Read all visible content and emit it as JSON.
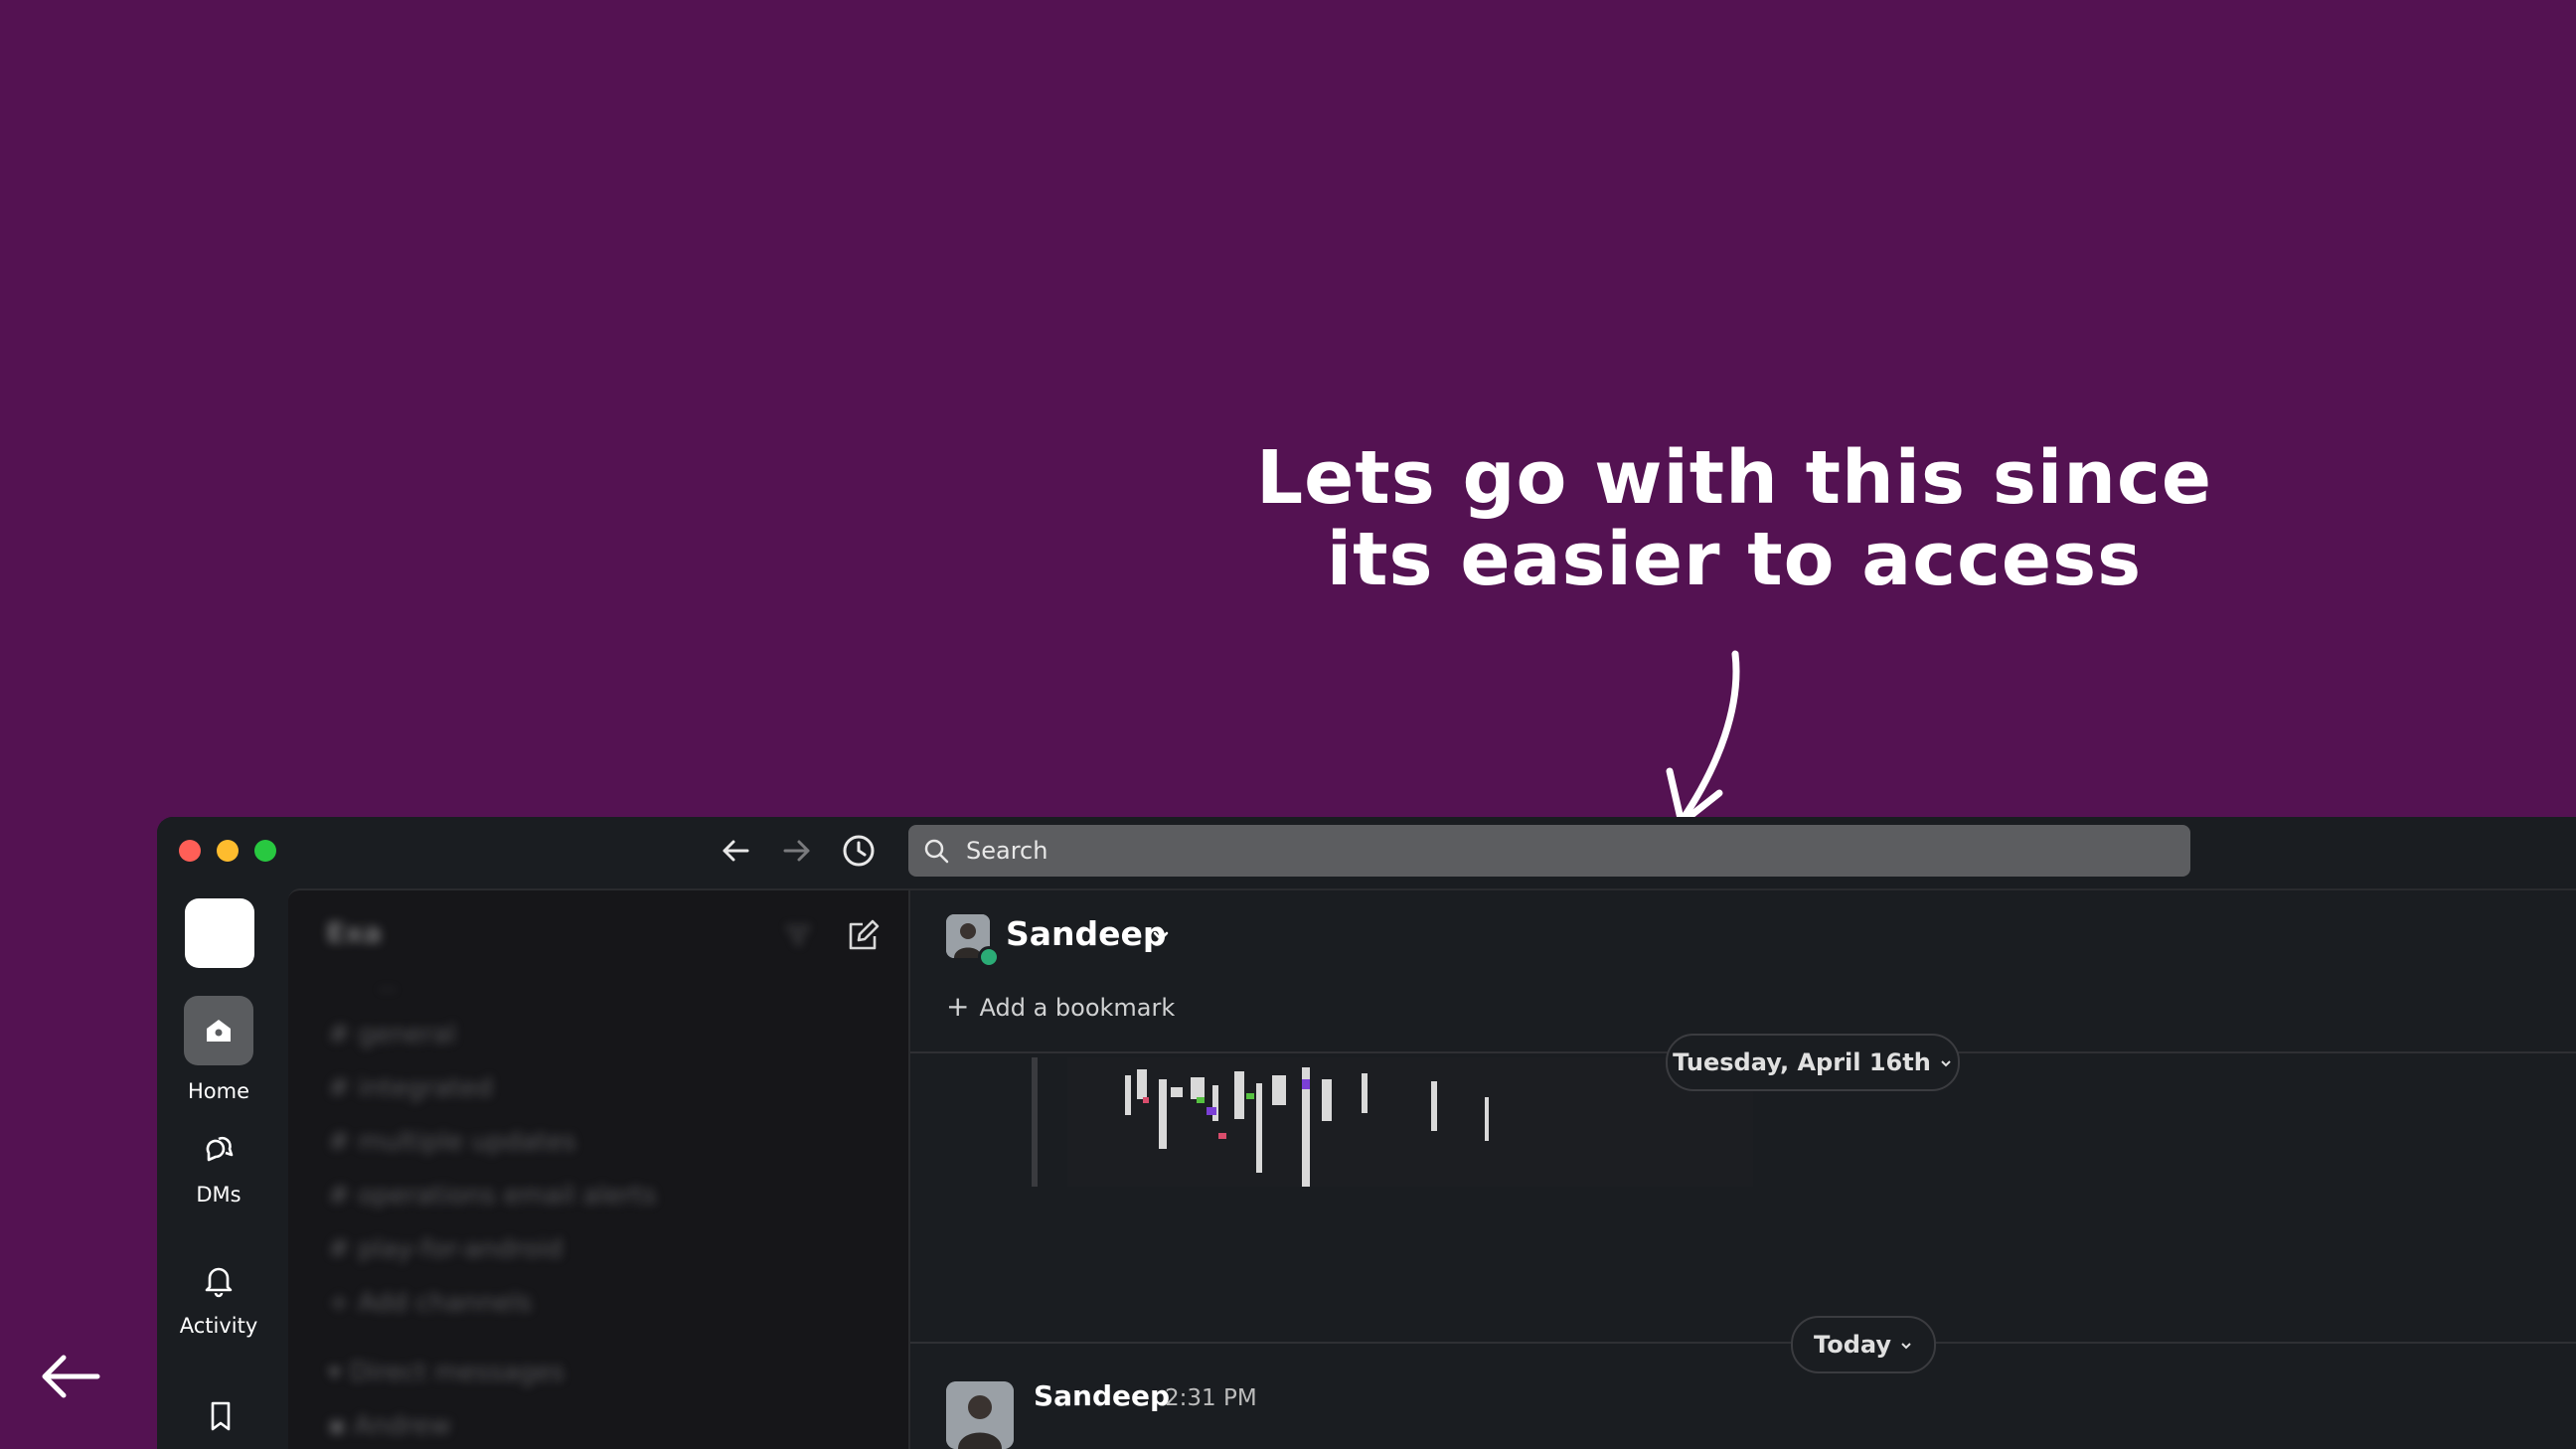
{
  "caption": {
    "line1": "Lets go with this since",
    "line2": "its easier to access"
  },
  "titlebar": {
    "search_placeholder": "Search"
  },
  "rail": {
    "items": [
      {
        "label": "Home",
        "icon": "home-icon"
      },
      {
        "label": "DMs",
        "icon": "dms-icon"
      },
      {
        "label": "Activity",
        "icon": "bell-icon"
      }
    ]
  },
  "sidebar": {
    "workspace": "Exa",
    "rows": [
      "...",
      "general",
      "integrated",
      "multiple updates",
      "operations email alerts",
      "play-for-android",
      "Add channels",
      "Direct messages",
      "Andrew"
    ]
  },
  "channel": {
    "name": "Sandeep",
    "bookmark_label": "Add a bookmark",
    "date_divider": "Tuesday, April 16th",
    "today_divider": "Today"
  },
  "message": {
    "author": "Sandeep",
    "time": "2:31 PM"
  },
  "colors": {
    "background": "#541252",
    "window": "#1a1d21",
    "accent_green": "#2bac76"
  }
}
